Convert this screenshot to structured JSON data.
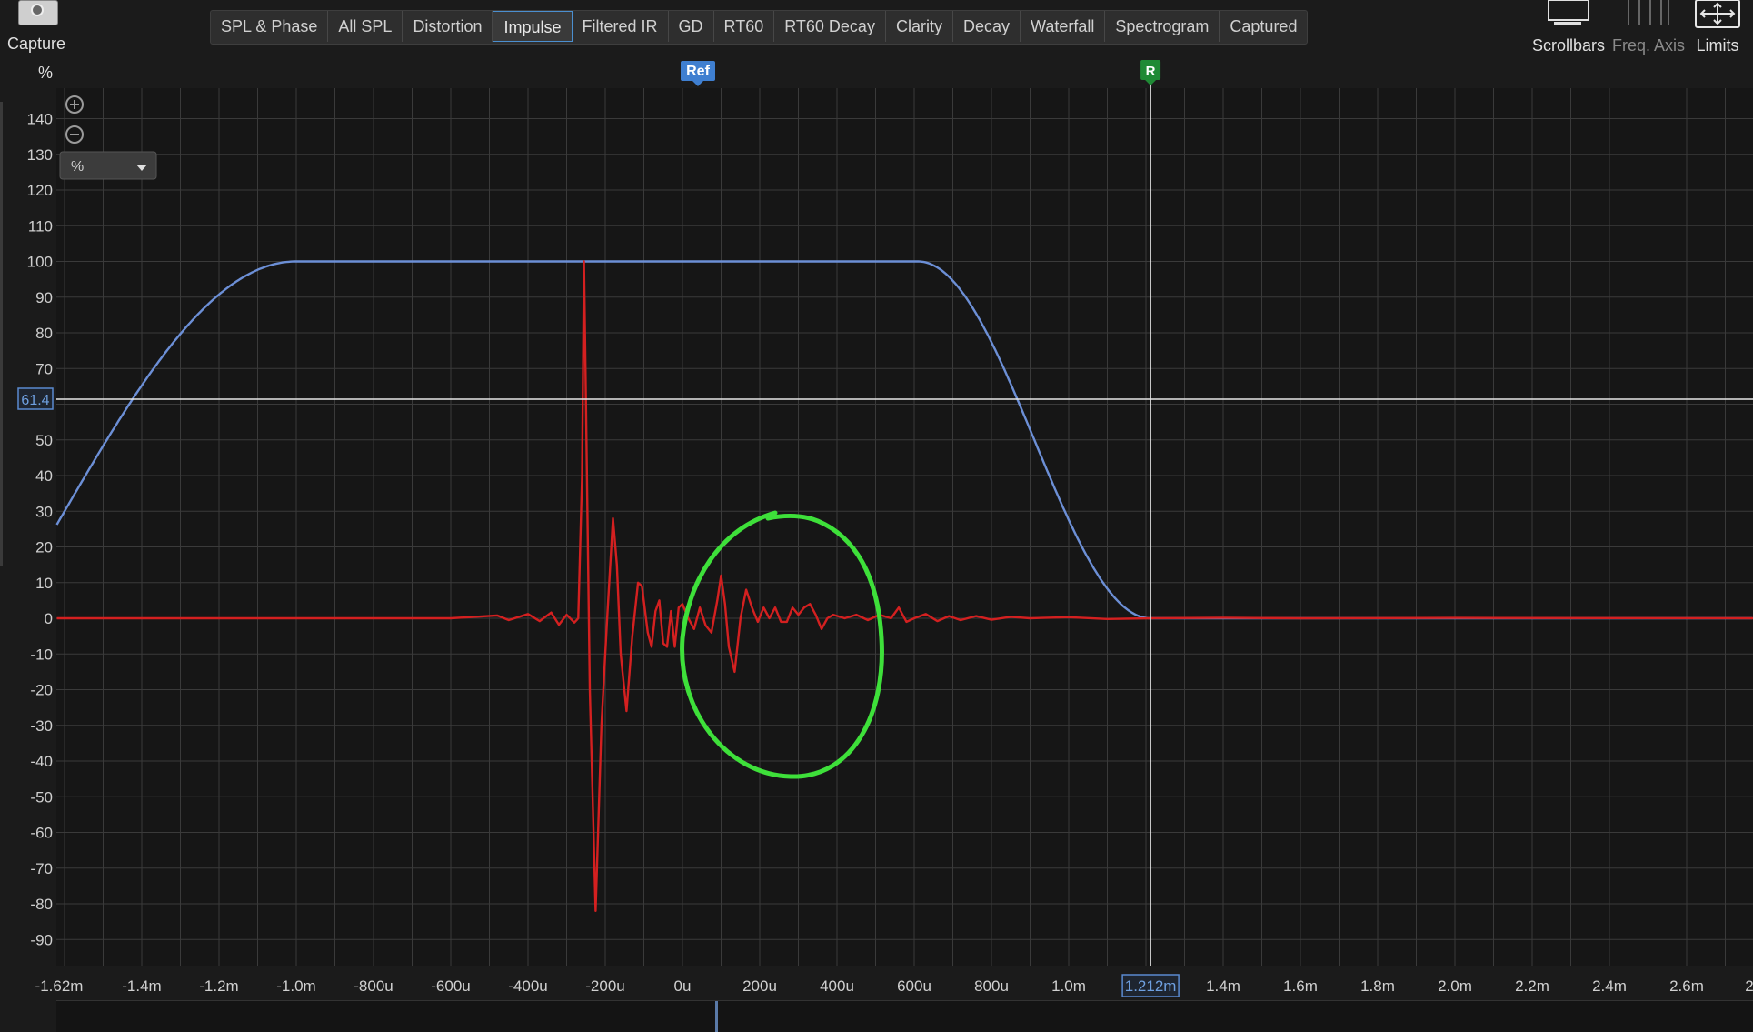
{
  "capture": {
    "label": "Capture"
  },
  "tabs": [
    {
      "label": "SPL & Phase",
      "active": false
    },
    {
      "label": "All SPL",
      "active": false
    },
    {
      "label": "Distortion",
      "active": false
    },
    {
      "label": "Impulse",
      "active": true
    },
    {
      "label": "Filtered IR",
      "active": false
    },
    {
      "label": "GD",
      "active": false
    },
    {
      "label": "RT60",
      "active": false
    },
    {
      "label": "RT60 Decay",
      "active": false
    },
    {
      "label": "Clarity",
      "active": false
    },
    {
      "label": "Decay",
      "active": false
    },
    {
      "label": "Waterfall",
      "active": false
    },
    {
      "label": "Spectrogram",
      "active": false
    },
    {
      "label": "Captured",
      "active": false
    }
  ],
  "right_tools": {
    "scrollbars": "Scrollbars",
    "freq_axis": "Freq. Axis",
    "limits": "Limits"
  },
  "plot": {
    "unit_label": "%",
    "unit_select": "%",
    "y_ticks": [
      "140",
      "130",
      "120",
      "110",
      "100",
      "90",
      "80",
      "70",
      "50",
      "40",
      "30",
      "20",
      "10",
      "0",
      "-10",
      "-20",
      "-30",
      "-40",
      "-50",
      "-60",
      "-70",
      "-80",
      "-90"
    ],
    "x_ticks": [
      "-1.62m",
      "-1.4m",
      "-1.2m",
      "-1.0m",
      "-800u",
      "-600u",
      "-400u",
      "-200u",
      "0u",
      "200u",
      "400u",
      "600u",
      "800u",
      "1.0m",
      "1.4m",
      "1.6m",
      "1.8m",
      "2.0m",
      "2.2m",
      "2.4m",
      "2.6m",
      "2"
    ],
    "cursor_y_readout": "61.4",
    "cursor_x_readout": "1.212m",
    "ref_marker": "Ref",
    "r_marker": "R",
    "colors": {
      "background": "#161616",
      "grid": "#3a3a3a",
      "impulse": "#d42020",
      "window": "#6c8fd6",
      "annotation": "#3ee03a",
      "cursor": "#e6e6e6"
    }
  }
}
